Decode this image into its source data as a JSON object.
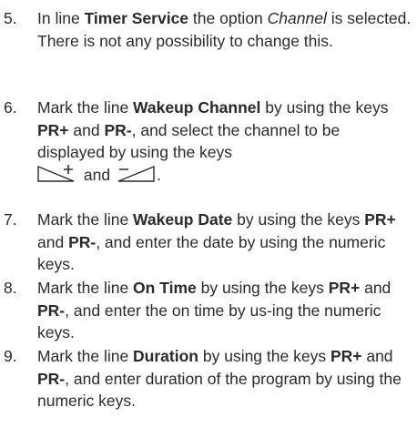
{
  "steps": [
    {
      "number": "5.",
      "t1": "In line ",
      "b1": "Timer Service",
      "t2": " the option ",
      "i1": "Channel",
      "t3": " is selected. There is not any possibility to change this."
    },
    {
      "number": "6.",
      "t1": "Mark the line ",
      "b1": "Wakeup Channel",
      "t2": " by using the keys ",
      "b2": "PR+",
      "t3": " and ",
      "b3": "PR-",
      "t4": ", and select the channel to be displayed by using the keys ",
      "t5": " and ",
      "t6": ".",
      "icon_plus": "volume-up-icon",
      "icon_minus": "volume-down-icon"
    },
    {
      "number": "7.",
      "t1": "Mark the line ",
      "b1": "Wakeup Date",
      "t2": " by using the keys ",
      "b2": "PR+",
      "t3": " and ",
      "b3": "PR-",
      "t4": ", and enter the date by using the numeric keys."
    },
    {
      "number": "8.",
      "t1": "Mark the line ",
      "b1": "On Time",
      "t2": " by using the keys ",
      "b2": "PR+",
      "t3": " and ",
      "b3": "PR-",
      "t4": ", and enter the on time by us-ing the numeric keys."
    },
    {
      "number": "9.",
      "t1": "Mark the line ",
      "b1": "Duration",
      "t2": " by using the keys ",
      "b2": "PR+",
      "t3": " and ",
      "b3": "PR-",
      "t4": ", and enter duration of the program by using the numeric keys."
    }
  ]
}
